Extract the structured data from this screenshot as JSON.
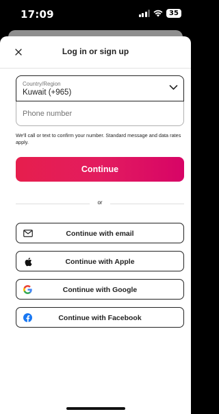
{
  "status_bar": {
    "time": "17:09",
    "battery": "35"
  },
  "sheet": {
    "title": "Log in or sign up"
  },
  "phone_form": {
    "country_label": "Country/Region",
    "country_value": "Kuwait (+965)",
    "phone_placeholder": "Phone number",
    "phone_value": "",
    "disclaimer": "We'll call or text to confirm your number. Standard message and data rates apply."
  },
  "continue_label": "Continue",
  "divider_text": "or",
  "social_buttons": {
    "email": {
      "label": "Continue with email",
      "icon": "envelope-icon"
    },
    "apple": {
      "label": "Continue with Apple",
      "icon": "apple-icon"
    },
    "google": {
      "label": "Continue with Google",
      "icon": "google-icon"
    },
    "facebook": {
      "label": "Continue with Facebook",
      "icon": "facebook-icon"
    }
  },
  "colors": {
    "brand_primary": "#E61E4D",
    "brand_secondary": "#D70466",
    "text_primary": "#222222",
    "text_secondary": "#717171",
    "facebook_blue": "#1877F2"
  }
}
